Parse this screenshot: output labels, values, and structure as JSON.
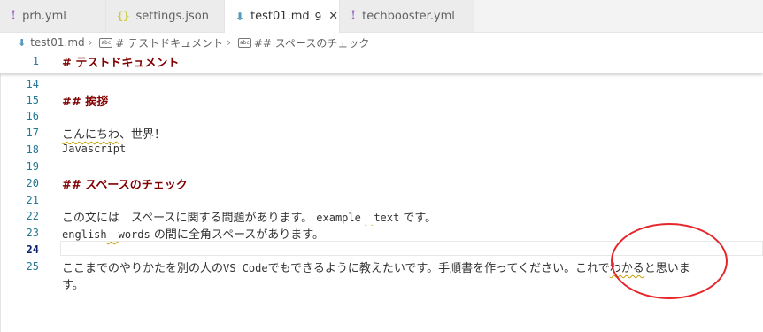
{
  "tabs": [
    {
      "label": "prh.yml",
      "icon": "!",
      "active": false
    },
    {
      "label": "settings.json",
      "icon": "{}",
      "active": false
    },
    {
      "label": "test01.md",
      "icon": "⬇",
      "count": "9",
      "close": "✕",
      "active": true
    },
    {
      "label": "techbooster.yml",
      "icon": "!",
      "active": false
    }
  ],
  "breadcrumb": {
    "file": "test01.md",
    "item1": "# テストドキュメント",
    "item2": "## スペースのチェック",
    "symbol_icon": "abc",
    "sep": "›"
  },
  "sticky": {
    "num": "1",
    "text": "# テストドキュメント"
  },
  "lines": {
    "l14": {
      "num": "14",
      "text": ""
    },
    "l15": {
      "num": "15",
      "text": "## 挨拶"
    },
    "l16": {
      "num": "16",
      "text": ""
    },
    "l17": {
      "num": "17",
      "text_a": "こんにちわ",
      "text_b": "、世界！"
    },
    "l18": {
      "num": "18",
      "text": "Javascript"
    },
    "l19": {
      "num": "19",
      "text": ""
    },
    "l20": {
      "num": "20",
      "text": "## スペースのチェック"
    },
    "l21": {
      "num": "21",
      "text": ""
    },
    "l22": {
      "num": "22",
      "seg1": "この文には　スペースに関する問題があります。 ",
      "seg2": "example",
      "seg3": "  ",
      "seg4": "text",
      "seg5": " です。"
    },
    "l23": {
      "num": "23",
      "seg1": "english",
      "seg2": "　",
      "seg3": "words",
      "seg4": " の間に全角スペースがあります。"
    },
    "l24": {
      "num": "24",
      "text": ""
    },
    "l25": {
      "num": "25",
      "seg1": "ここまでのやりかたを別の人の",
      "seg2": "VS Code",
      "seg3": "でもできるように教えたいです。手順書を作ってください。",
      "seg4": "これで",
      "seg5": "わかる",
      "seg6": "と思いま",
      "cont": "す。"
    }
  },
  "colors": {
    "heading": "#800000",
    "line_number": "#237893",
    "squiggle": "#c4a000",
    "annotation": "#e5262a"
  }
}
